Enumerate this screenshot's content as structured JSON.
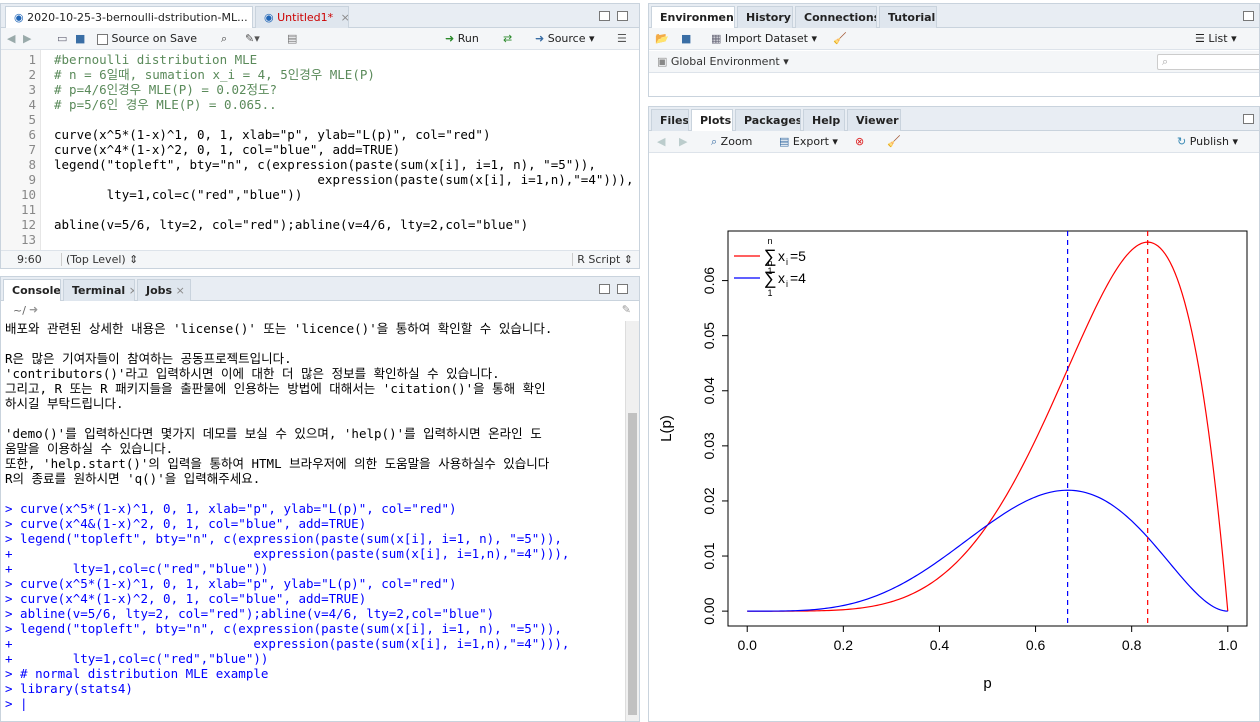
{
  "source_pane": {
    "tabs": [
      {
        "label": "2020-10-25-3-bernoulli-dstribution-ML...",
        "active": true
      },
      {
        "label": "Untitled1*",
        "active": false
      }
    ],
    "toolbar": {
      "source_on_save": "Source on Save",
      "run": "Run",
      "source": "Source"
    },
    "lines": [
      {
        "n": "1",
        "text": "#bernoulli distribution MLE"
      },
      {
        "n": "2",
        "text": "# n = 6일때, sumation x_i = 4, 5인경우 MLE(P)"
      },
      {
        "n": "3",
        "text": "# p=4/6인경우 MLE(P) = 0.02정도?"
      },
      {
        "n": "4",
        "text": "# p=5/6인 경우 MLE(P) = 0.065.."
      },
      {
        "n": "5",
        "text": ""
      },
      {
        "n": "6",
        "text": "curve(x^5*(1-x)^1, 0, 1, xlab=\"p\", ylab=\"L(p)\", col=\"red\")"
      },
      {
        "n": "7",
        "text": "curve(x^4*(1-x)^2, 0, 1, col=\"blue\", add=TRUE)"
      },
      {
        "n": "8",
        "text": "legend(\"topleft\", bty=\"n\", c(expression(paste(sum(x[i], i=1, n), \"=5\")),"
      },
      {
        "n": "9",
        "text": "                                   expression(paste(sum(x[i], i=1,n),\"=4\"))),"
      },
      {
        "n": "10",
        "text": "       lty=1,col=c(\"red\",\"blue\"))"
      },
      {
        "n": "11",
        "text": ""
      },
      {
        "n": "12",
        "text": "abline(v=5/6, lty=2, col=\"red\");abline(v=4/6, lty=2,col=\"blue\")"
      },
      {
        "n": "13",
        "text": ""
      }
    ],
    "status": {
      "position": "9:60",
      "scope": "(Top Level)",
      "filetype": "R Script"
    }
  },
  "console_pane": {
    "tabs": [
      {
        "label": "Console",
        "active": true
      },
      {
        "label": "Terminal",
        "active": false
      },
      {
        "label": "Jobs",
        "active": false
      }
    ],
    "path": "~/",
    "lines": [
      {
        "t": "o",
        "text": "배포와 관련된 상세한 내용은 'license()' 또는 'licence()'을 통하여 확인할 수 있습니다."
      },
      {
        "t": "o",
        "text": ""
      },
      {
        "t": "o",
        "text": "R은 많은 기여자들이 참여하는 공동프로젝트입니다."
      },
      {
        "t": "o",
        "text": "'contributors()'라고 입력하시면 이에 대한 더 많은 정보를 확인하실 수 있습니다."
      },
      {
        "t": "o",
        "text": "그리고, R 또는 R 패키지들을 출판물에 인용하는 방법에 대해서는 'citation()'을 통해 확인"
      },
      {
        "t": "o",
        "text": "하시길 부탁드립니다."
      },
      {
        "t": "o",
        "text": ""
      },
      {
        "t": "o",
        "text": "'demo()'를 입력하신다면 몇가지 데모를 보실 수 있으며, 'help()'를 입력하시면 온라인 도"
      },
      {
        "t": "o",
        "text": "움말을 이용하실 수 있습니다."
      },
      {
        "t": "o",
        "text": "또한, 'help.start()'의 입력을 통하여 HTML 브라우저에 의한 도움말을 사용하실수 있습니다"
      },
      {
        "t": "o",
        "text": "R의 종료를 원하시면 'q()'을 입력해주세요."
      },
      {
        "t": "o",
        "text": ""
      },
      {
        "t": "i",
        "text": "> curve(x^5*(1-x)^1, 0, 1, xlab=\"p\", ylab=\"L(p)\", col=\"red\")"
      },
      {
        "t": "i",
        "text": "> curve(x^4&(1-x)^2, 0, 1, col=\"blue\", add=TRUE)"
      },
      {
        "t": "i",
        "text": "> legend(\"topleft\", bty=\"n\", c(expression(paste(sum(x[i], i=1, n), \"=5\")),"
      },
      {
        "t": "i",
        "text": "+                                expression(paste(sum(x[i], i=1,n),\"=4\"))),"
      },
      {
        "t": "i",
        "text": "+        lty=1,col=c(\"red\",\"blue\"))"
      },
      {
        "t": "i",
        "text": "> curve(x^5*(1-x)^1, 0, 1, xlab=\"p\", ylab=\"L(p)\", col=\"red\")"
      },
      {
        "t": "i",
        "text": "> curve(x^4*(1-x)^2, 0, 1, col=\"blue\", add=TRUE)"
      },
      {
        "t": "i",
        "text": "> abline(v=5/6, lty=2, col=\"red\");abline(v=4/6, lty=2,col=\"blue\")"
      },
      {
        "t": "i",
        "text": "> legend(\"topleft\", bty=\"n\", c(expression(paste(sum(x[i], i=1, n), \"=5\")),"
      },
      {
        "t": "i",
        "text": "+                                expression(paste(sum(x[i], i=1,n),\"=4\"))),"
      },
      {
        "t": "i",
        "text": "+        lty=1,col=c(\"red\",\"blue\"))"
      },
      {
        "t": "i",
        "text": "> # normal distribution MLE example"
      },
      {
        "t": "i",
        "text": "> library(stats4)"
      },
      {
        "t": "i",
        "text": "> |"
      }
    ]
  },
  "env_pane": {
    "tabs": [
      {
        "label": "Environment",
        "active": true
      },
      {
        "label": "History",
        "active": false
      },
      {
        "label": "Connections",
        "active": false
      },
      {
        "label": "Tutorial",
        "active": false
      }
    ],
    "import_dataset": "Import Dataset",
    "list_view": "List",
    "global_env": "Global Environment"
  },
  "plots_pane": {
    "tabs": [
      {
        "label": "Files",
        "active": false
      },
      {
        "label": "Plots",
        "active": true
      },
      {
        "label": "Packages",
        "active": false
      },
      {
        "label": "Help",
        "active": false
      },
      {
        "label": "Viewer",
        "active": false
      }
    ],
    "zoom": "Zoom",
    "export": "Export",
    "publish": "Publish"
  },
  "chart_data": {
    "type": "line",
    "xlabel": "p",
    "ylabel": "L(p)",
    "xlim": [
      0,
      1
    ],
    "ylim": [
      0,
      0.069
    ],
    "xticks": [
      "0.0",
      "0.2",
      "0.4",
      "0.6",
      "0.8",
      "1.0"
    ],
    "yticks": [
      "0.00",
      "0.01",
      "0.02",
      "0.03",
      "0.04",
      "0.05",
      "0.06"
    ],
    "series": [
      {
        "name": "x^5(1-x)",
        "color": "#ff0000",
        "formula": "x^5*(1-x)^1"
      },
      {
        "name": "x^4(1-x)^2",
        "color": "#0000ff",
        "formula": "x^4*(1-x)^2"
      }
    ],
    "vlines": [
      {
        "x": 0.8333,
        "color": "#ff0000",
        "lty": "dashed"
      },
      {
        "x": 0.6667,
        "color": "#0000ff",
        "lty": "dashed"
      }
    ],
    "legend": {
      "position": "top-left",
      "entries": [
        {
          "sum_top": "n",
          "sum_bottom": "1",
          "term": "x",
          "sub": "i",
          "rhs": "=5",
          "color": "#ff0000"
        },
        {
          "sum_top": "n",
          "sum_bottom": "1",
          "term": "x",
          "sub": "i",
          "rhs": "=4",
          "color": "#0000ff"
        }
      ]
    }
  }
}
